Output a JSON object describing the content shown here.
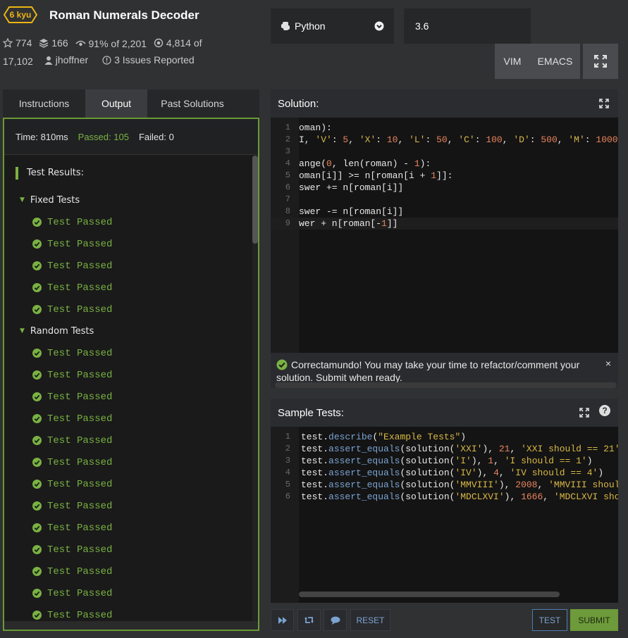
{
  "kata": {
    "rank": "6 kyu",
    "title": "Roman Numerals Decoder",
    "stars": "774",
    "collections": "166",
    "satisfaction": "91%",
    "satisfaction_of": "of 2,201",
    "completions": "4,814",
    "completions_of": "of",
    "completions_total": "17,102",
    "author": "jhoffner",
    "issues": "3 Issues Reported"
  },
  "editor_settings": {
    "language": "Python",
    "version": "3.6",
    "vim_label": "VIM",
    "emacs_label": "EMACS"
  },
  "tabs": [
    {
      "label": "Instructions"
    },
    {
      "label": "Output"
    },
    {
      "label": "Past Solutions"
    }
  ],
  "output": {
    "time": "Time: 810ms",
    "passed": "Passed: 105",
    "failed": "Failed: 0",
    "results_title": "Test Results:",
    "fixed_group": "Fixed Tests",
    "random_group": "Random Tests",
    "passed_text": "Test Passed"
  },
  "solution": {
    "title": "Solution:",
    "lines": [
      "1",
      "2",
      "3",
      "4",
      "5",
      "6",
      "7",
      "8",
      "9"
    ]
  },
  "notice": {
    "text": "Correctamundo! You may take your time to refactor/comment your solution. Submit when ready.",
    "close": "×"
  },
  "sample_tests": {
    "title": "Sample Tests:",
    "help": "?",
    "lines": [
      "1",
      "2",
      "3",
      "4",
      "5",
      "6"
    ]
  },
  "buttons": {
    "reset": "RESET",
    "test": "TEST",
    "submit": "SUBMIT"
  },
  "colors": {
    "accent_green": "#79b242",
    "rank_yellow": "#ecb613",
    "link_blue": "#7aa3d2"
  }
}
